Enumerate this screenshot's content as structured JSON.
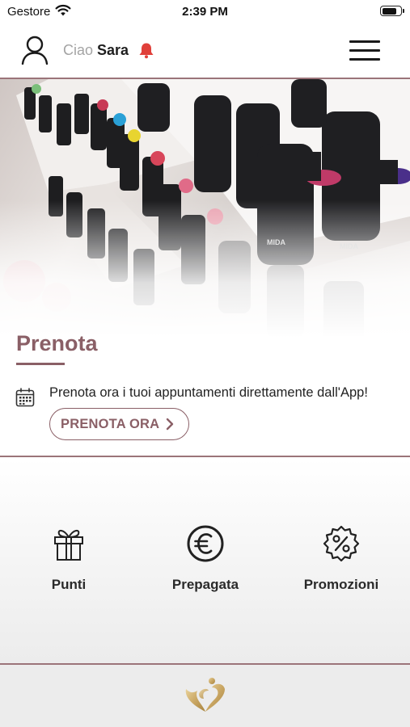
{
  "status_bar": {
    "carrier": "Gestore",
    "time": "2:39 PM",
    "battery_level": 0.85
  },
  "header": {
    "greeting": "Ciao",
    "user_name": "Sara",
    "icons": [
      "user-icon",
      "bell-icon",
      "menu-icon"
    ]
  },
  "colors": {
    "accent": "#8a5f66",
    "bell": "#e0403a",
    "divider": "#9b7479"
  },
  "prenota": {
    "title": "Prenota",
    "description": "Prenota ora i tuoi appuntamenti direttamente dall'App!",
    "button_label": "PRENOTA ORA"
  },
  "features": [
    {
      "label": "Punti",
      "icon": "gift-icon"
    },
    {
      "label": "Prepagata",
      "icon": "euro-icon"
    },
    {
      "label": "Promozioni",
      "icon": "discount-badge-icon"
    }
  ]
}
